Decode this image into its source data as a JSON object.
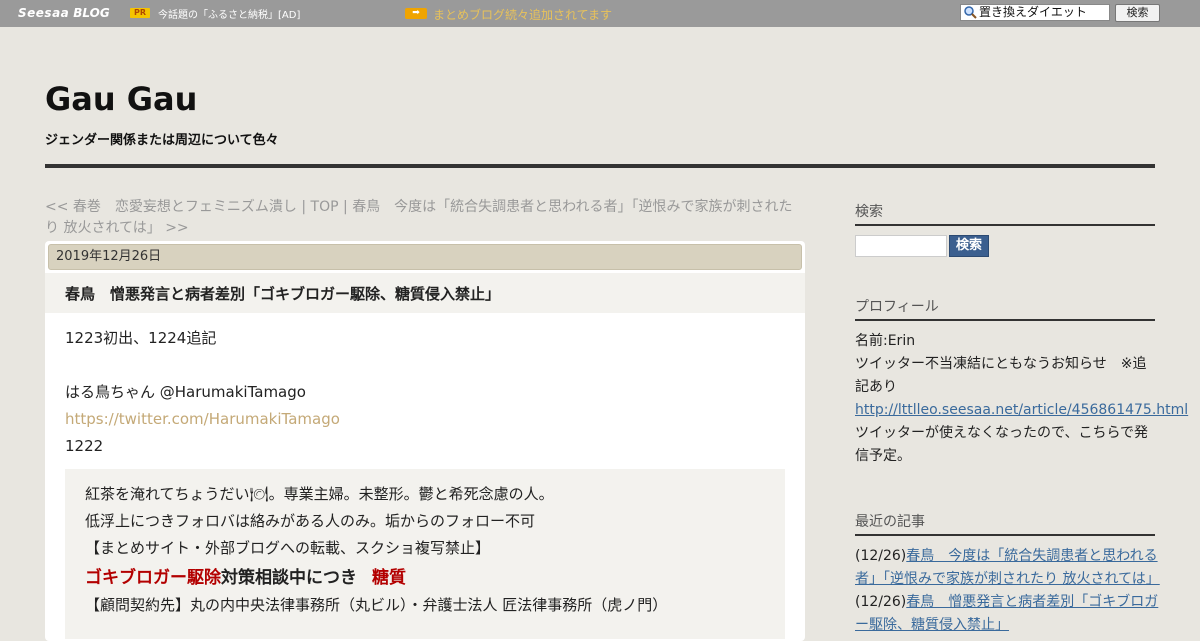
{
  "topbar": {
    "brand_seesaa": "Seesaa",
    "brand_blog": "BLOG",
    "pr_badge": "PR",
    "pr_text": "今話題の「ふるさと納税」[AD]",
    "arrow_glyph": "➡",
    "notice": "まとめブログ続々追加されてます",
    "search_value": "置き換えダイエット",
    "search_button": "検索"
  },
  "header": {
    "title": "Gau Gau",
    "description": "ジェンダー関係または周辺について色々"
  },
  "pager": {
    "prev": "<< 春巻　恋愛妄想とフェミニズム潰し",
    "sep1": " | ",
    "top": "TOP",
    "sep2": " | ",
    "next": "春鳥　今度は「統合失調患者と思われる者」「逆恨みで家族が刺されたり 放火されては」 >>"
  },
  "article": {
    "date": "2019年12月26日",
    "title": "春鳥　憎悪発言と病者差別「ゴキブロガー駆除、糖質侵入禁止」",
    "line1": "1223初出、1224追記",
    "line2": "はる鳥ちゃん  @HarumakiTamago",
    "link": "https://twitter.com/HarumakiTamago",
    "line3": "1222",
    "quote": {
      "l1": "紅茶を淹れてちょうだい🍽。専業主婦。未整形。鬱と希死念慮の人。",
      "l2": "低浮上につきフォロバは絡みがある人のみ。垢からのフォロー不可",
      "l3": "【まとめサイト・外部ブログへの転載、スクショ複写禁止】",
      "l4_red": "ゴキブロガー駆除",
      "l4_bold": "対策相談中につき",
      "l4_red2": "糖質",
      "l5": "【顧問契約先】丸の内中央法律事務所（丸ビル）・弁護士法人 匠法律事務所（虎ノ門）"
    }
  },
  "sidebar": {
    "search_head": "検索",
    "search_button": "検索",
    "profile_head": "プロフィール",
    "profile_name": "名前:Erin",
    "profile_text1": "ツイッター不当凍結にともなうお知らせ　※追記あり",
    "profile_link": "http://lttlleo.seesaa.net/article/456861475.html",
    "profile_text2": "ツイッターが使えなくなったので、こちらで発信予定。",
    "recent_head": "最近の記事",
    "recent": [
      {
        "date": "(12/26)",
        "title": "春鳥　今度は「統合失調患者と思われる者」「逆恨みで家族が刺されたり 放火されては」"
      },
      {
        "date": "(12/26)",
        "title": "春鳥　憎悪発言と病者差別「ゴキブロガー駆除、糖質侵入禁止」"
      }
    ]
  }
}
